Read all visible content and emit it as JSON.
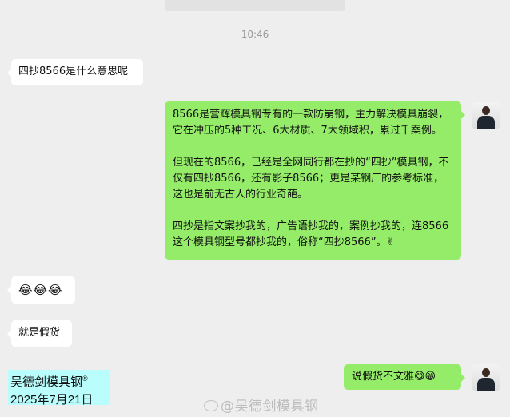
{
  "chat": {
    "timestamp": "10:46",
    "messages": [
      {
        "side": "left",
        "text": "四抄8566是什么意思呢"
      },
      {
        "side": "right",
        "paragraphs": [
          "8566是营辉模具钢专有的一款防崩钢，主力解决模具崩裂，它在冲压的5种工况、6大材质、7大领域积，累过千案例。",
          "但现在的8566，已经是全网同行都在抄的“四抄”模具钢，不仅有四抄8566，还有影子8566；更是某钢厂的参考标准，这也是前无古人的行业奇葩。",
          "四抄是指文案抄我的，广告语抄我的，案例抄我的，连8566这个模具钢型号都抄我的，俗称“四抄8566”。✌"
        ]
      },
      {
        "side": "left",
        "text": "😂😂😂"
      },
      {
        "side": "left",
        "text": "就是假货"
      },
      {
        "side": "right",
        "text": "说假货不文雅😋😁"
      }
    ]
  },
  "caption": {
    "line1": "吴德剑模具钢",
    "mark": "®",
    "line2": "2025年7月21日"
  },
  "watermark": {
    "text": "@吴德剑模具钢",
    "icon": "weibo-icon"
  },
  "colors": {
    "background": "#eeeeee",
    "sent_bubble": "#95ec69",
    "received_bubble": "#ffffff",
    "caption_bg": "#b9fdfd"
  }
}
